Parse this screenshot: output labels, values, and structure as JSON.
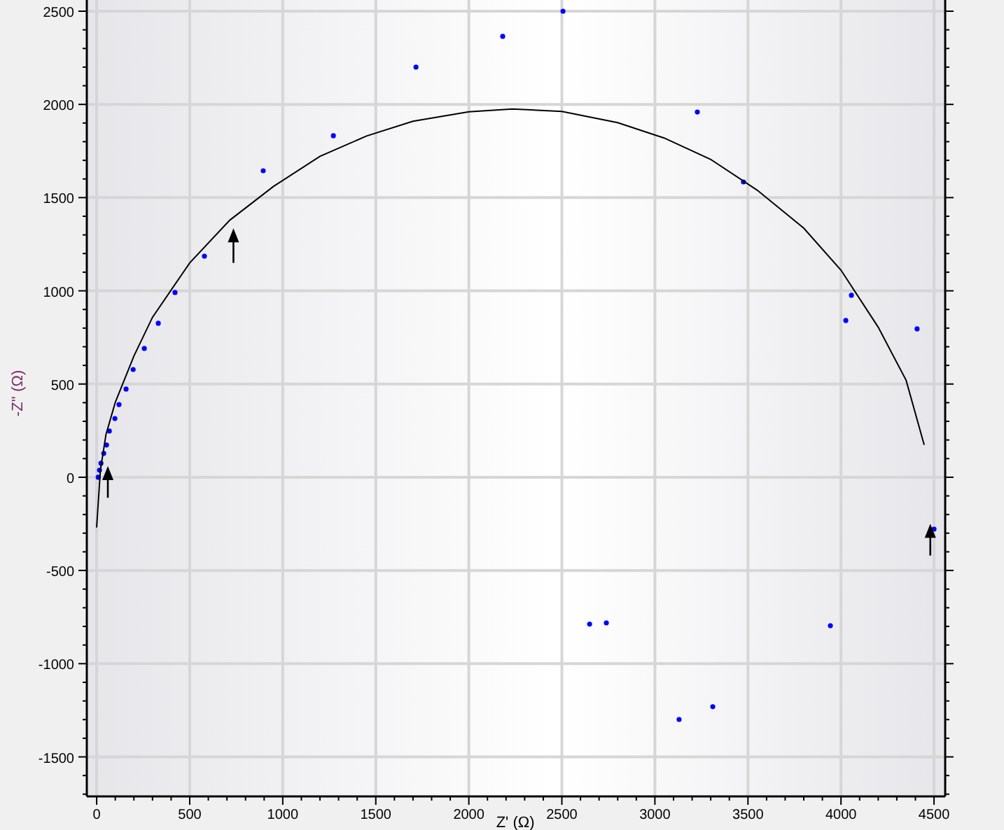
{
  "chart_data": {
    "type": "scatter",
    "xlabel": "Z' (Ω)",
    "ylabel": "-Z'' (Ω)",
    "xlim": [
      -53,
      4560
    ],
    "ylim": [
      -1712,
      2560
    ],
    "grid": true,
    "xticks": [
      0,
      500,
      1000,
      1500,
      2000,
      2500,
      3000,
      3500,
      4000,
      4500
    ],
    "yticks": [
      -1500,
      -1000,
      -500,
      0,
      500,
      1000,
      1500,
      2000,
      2500
    ],
    "series": [
      {
        "type": "scatter",
        "color": "#0000ff",
        "x": [
          8,
          15,
          23,
          38,
          53,
          68,
          98,
          120,
          158,
          196,
          256,
          331,
          421,
          579,
          895,
          1272,
          1716,
          2182,
          2506,
          3228,
          3476,
          4056,
          4026,
          4409,
          2649,
          2739,
          3130,
          3311,
          3943,
          4500
        ],
        "values": [
          0,
          38,
          75,
          128,
          173,
          248,
          315,
          390,
          473,
          578,
          691,
          826,
          991,
          1186,
          1644,
          1832,
          2200,
          2365,
          2500,
          1959,
          1584,
          976,
          841,
          796,
          -788,
          -781,
          -1299,
          -1231,
          -796,
          -278
        ]
      },
      {
        "type": "line",
        "color": "#000000",
        "x": [
          0,
          20,
          50,
          100,
          200,
          300,
          500,
          715,
          950,
          1200,
          1450,
          1700,
          2000,
          2235,
          2500,
          2800,
          3050,
          3300,
          3550,
          3800,
          4000,
          4200,
          4350,
          4447
        ],
        "values": [
          -270,
          38,
          230,
          401,
          650,
          858,
          1150,
          1379,
          1560,
          1721,
          1830,
          1910,
          1960,
          1975,
          1962,
          1902,
          1820,
          1705,
          1540,
          1336,
          1111,
          805,
          520,
          173
        ]
      }
    ]
  }
}
